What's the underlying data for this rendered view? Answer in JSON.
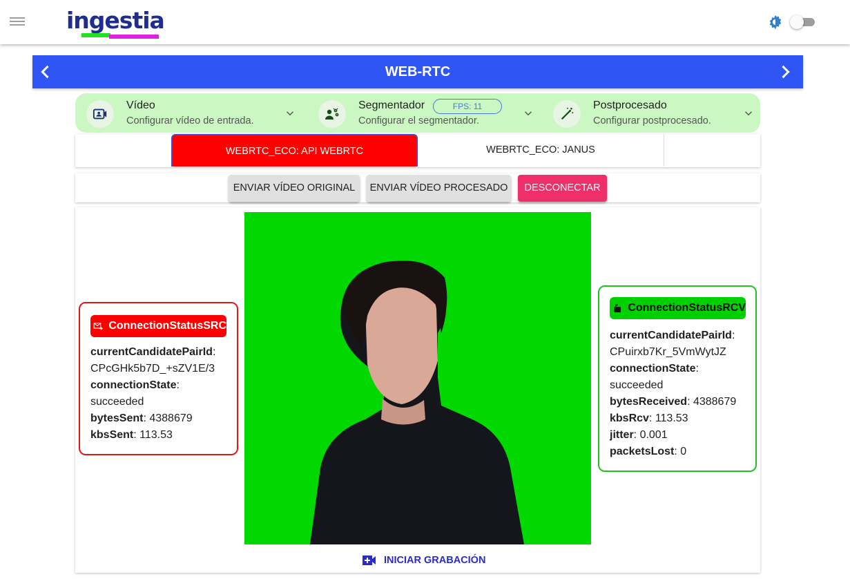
{
  "appbar": {
    "logo_text": "ingestia",
    "logo_colors": {
      "text": "#1e2d8f",
      "green": "#20e020",
      "magenta": "#e020e0"
    },
    "theme_icon": "brightness-icon",
    "dark_mode_toggle": false
  },
  "header": {
    "title": "WEB-RTC",
    "color": "#2f55f5"
  },
  "config": {
    "items": [
      {
        "title": "Vídeo",
        "subtitle": "Configurar vídeo de entrada.",
        "icon": "video-account-icon"
      },
      {
        "title": "Segmentador",
        "subtitle": "Configurar el segmentador.",
        "icon": "segmenter-icon",
        "chip": "FPS: 11"
      },
      {
        "title": "Postprocesado",
        "subtitle": "Configurar postprocesado.",
        "icon": "magic-wand-icon"
      }
    ],
    "bg_color": "#cbf7c2"
  },
  "tabs": [
    {
      "label": "WEBRTC_ECO: API WEBRTC",
      "active": true
    },
    {
      "label": "WEBRTC_ECO: JANUS",
      "active": false
    }
  ],
  "actions": {
    "send_original": "ENVIAR VÍDEO ORIGINAL",
    "send_processed": "ENVIAR VÍDEO PROCESADO",
    "disconnect": "DESCONECTAR"
  },
  "record": {
    "label": "INICIAR GRABACIÓN"
  },
  "status_src": {
    "title": "ConnectionStatusSRC",
    "fields": [
      {
        "key": "currentCandidatePairId",
        "value": "CPcGHk5b7D_+sZV1E/3"
      },
      {
        "key": "connectionState",
        "value": "succeeded"
      },
      {
        "key": "bytesSent",
        "value": "4388679"
      },
      {
        "key": "kbsSent",
        "value": "113.53"
      }
    ]
  },
  "status_rcv": {
    "title": "ConnectionStatusRCV",
    "fields": [
      {
        "key": "currentCandidatePairId",
        "value": "CPuirxb7Kr_5VmWytJZ"
      },
      {
        "key": "connectionState",
        "value": "succeeded"
      },
      {
        "key": "bytesReceived",
        "value": "4388679"
      },
      {
        "key": "kbsRcv",
        "value": "113.53"
      },
      {
        "key": "jitter",
        "value": "0.001"
      },
      {
        "key": "packetsLost",
        "value": "0"
      }
    ]
  }
}
